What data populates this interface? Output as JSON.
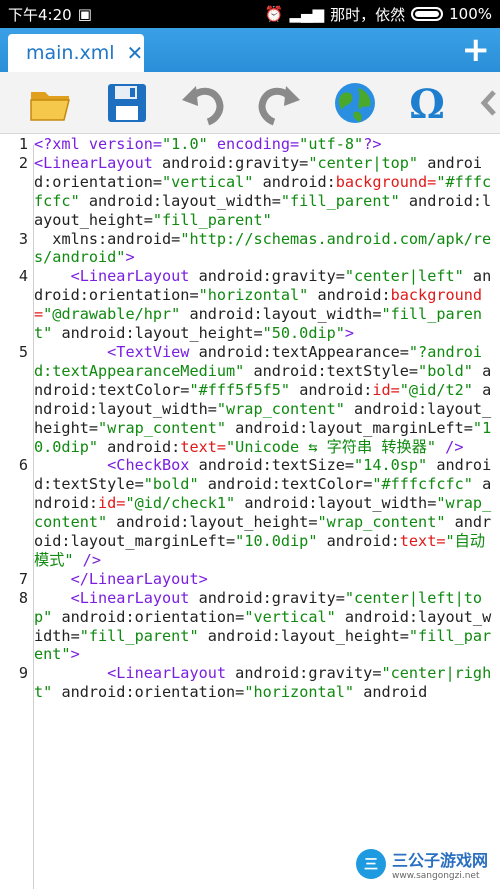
{
  "status_bar": {
    "time": "下午4:20",
    "carrier": "那时，依然",
    "battery": "100%"
  },
  "tab": {
    "title": "main.xml",
    "close": "✕"
  },
  "add_tab": "+",
  "toolbar": [
    "folder-open-icon",
    "save-icon",
    "undo-icon",
    "redo-icon",
    "globe-icon",
    "omega-icon",
    "scroll-left-icon"
  ],
  "code_lines": [
    {
      "n": "1",
      "tokens": [
        [
          "t",
          "<?xml version="
        ],
        [
          "v",
          "\"1.0\""
        ],
        [
          "t",
          " encoding="
        ],
        [
          "v",
          "\"utf-8\""
        ],
        [
          "t",
          "?>"
        ]
      ]
    },
    {
      "n": "2",
      "tokens": [
        [
          "t",
          "<LinearLayout"
        ],
        [
          "n",
          " android:gravity="
        ],
        [
          "v",
          "\"center|top\""
        ],
        [
          "n",
          " android:orientation="
        ],
        [
          "v",
          "\"vertical\""
        ],
        [
          "n",
          " android:"
        ],
        [
          "r",
          "background="
        ],
        [
          "v",
          "\"#fffcfcfc\""
        ],
        [
          "n",
          " android:layout_width="
        ],
        [
          "v",
          "\"fill_parent\""
        ],
        [
          "n",
          " android:layout_height="
        ],
        [
          "v",
          "\"fill_parent\""
        ]
      ]
    },
    {
      "n": "3",
      "tokens": [
        [
          "n",
          "  xmlns:android="
        ],
        [
          "v",
          "\"http://schemas.android.com/apk/res/android\""
        ],
        [
          "t",
          ">"
        ]
      ]
    },
    {
      "n": "4",
      "tokens": [
        [
          "t",
          "    <LinearLayout"
        ],
        [
          "n",
          " android:gravity="
        ],
        [
          "v",
          "\"center|left\""
        ],
        [
          "n",
          " android:orientation="
        ],
        [
          "v",
          "\"horizontal\""
        ],
        [
          "n",
          " android:"
        ],
        [
          "r",
          "background="
        ],
        [
          "v",
          "\"@drawable/hpr\""
        ],
        [
          "n",
          " android:layout_width="
        ],
        [
          "v",
          "\"fill_parent\""
        ],
        [
          "n",
          " android:layout_height="
        ],
        [
          "v",
          "\"50.0dip\""
        ],
        [
          "t",
          ">"
        ]
      ]
    },
    {
      "n": "5",
      "tokens": [
        [
          "t",
          "        <TextView"
        ],
        [
          "n",
          " android:textAppearance="
        ],
        [
          "v",
          "\"?android:textAppearanceMedium\""
        ],
        [
          "n",
          " android:textStyle="
        ],
        [
          "v",
          "\"bold\""
        ],
        [
          "n",
          " android:textColor="
        ],
        [
          "v",
          "\"#fff5f5f5\""
        ],
        [
          "n",
          " android:"
        ],
        [
          "r",
          "id="
        ],
        [
          "v",
          "\"@id/t2\""
        ],
        [
          "n",
          " android:layout_width="
        ],
        [
          "v",
          "\"wrap_content\""
        ],
        [
          "n",
          " android:layout_height="
        ],
        [
          "v",
          "\"wrap_content\""
        ],
        [
          "n",
          " android:layout_marginLeft="
        ],
        [
          "v",
          "\"10.0dip\""
        ],
        [
          "n",
          " android:"
        ],
        [
          "r",
          "text="
        ],
        [
          "v",
          "\"Unicode ⇆ 字符串 转换器\""
        ],
        [
          "t",
          " />"
        ]
      ]
    },
    {
      "n": "6",
      "tokens": [
        [
          "t",
          "        <CheckBox"
        ],
        [
          "n",
          " android:textSize="
        ],
        [
          "v",
          "\"14.0sp\""
        ],
        [
          "n",
          " android:textStyle="
        ],
        [
          "v",
          "\"bold\""
        ],
        [
          "n",
          " android:textColor="
        ],
        [
          "v",
          "\"#fffcfcfc\""
        ],
        [
          "n",
          " android:"
        ],
        [
          "r",
          "id="
        ],
        [
          "v",
          "\"@id/check1\""
        ],
        [
          "n",
          " android:layout_width="
        ],
        [
          "v",
          "\"wrap_content\""
        ],
        [
          "n",
          " android:layout_height="
        ],
        [
          "v",
          "\"wrap_content\""
        ],
        [
          "n",
          " android:layout_marginLeft="
        ],
        [
          "v",
          "\"10.0dip\""
        ],
        [
          "n",
          " android:"
        ],
        [
          "r",
          "text="
        ],
        [
          "v",
          "\"自动模式\""
        ],
        [
          "t",
          " />"
        ]
      ]
    },
    {
      "n": "7",
      "tokens": [
        [
          "t",
          "    </LinearLayout>"
        ]
      ]
    },
    {
      "n": "8",
      "tokens": [
        [
          "t",
          "    <LinearLayout"
        ],
        [
          "n",
          " android:gravity="
        ],
        [
          "v",
          "\"center|left|top\""
        ],
        [
          "n",
          " android:orientation="
        ],
        [
          "v",
          "\"vertical\""
        ],
        [
          "n",
          " android:layout_width="
        ],
        [
          "v",
          "\"fill_parent\""
        ],
        [
          "n",
          " android:layout_height="
        ],
        [
          "v",
          "\"fill_parent\""
        ],
        [
          "t",
          ">"
        ]
      ]
    },
    {
      "n": "9",
      "tokens": [
        [
          "t",
          "        <LinearLayout"
        ],
        [
          "n",
          " android:gravity="
        ],
        [
          "v",
          "\"center|right\""
        ],
        [
          "n",
          " android:orientation="
        ],
        [
          "v",
          "\"horizontal\""
        ],
        [
          "n",
          " android"
        ]
      ]
    }
  ],
  "watermark": {
    "logo": "三",
    "title": "三公子游戏网",
    "url": "www.sangongzi.net"
  }
}
